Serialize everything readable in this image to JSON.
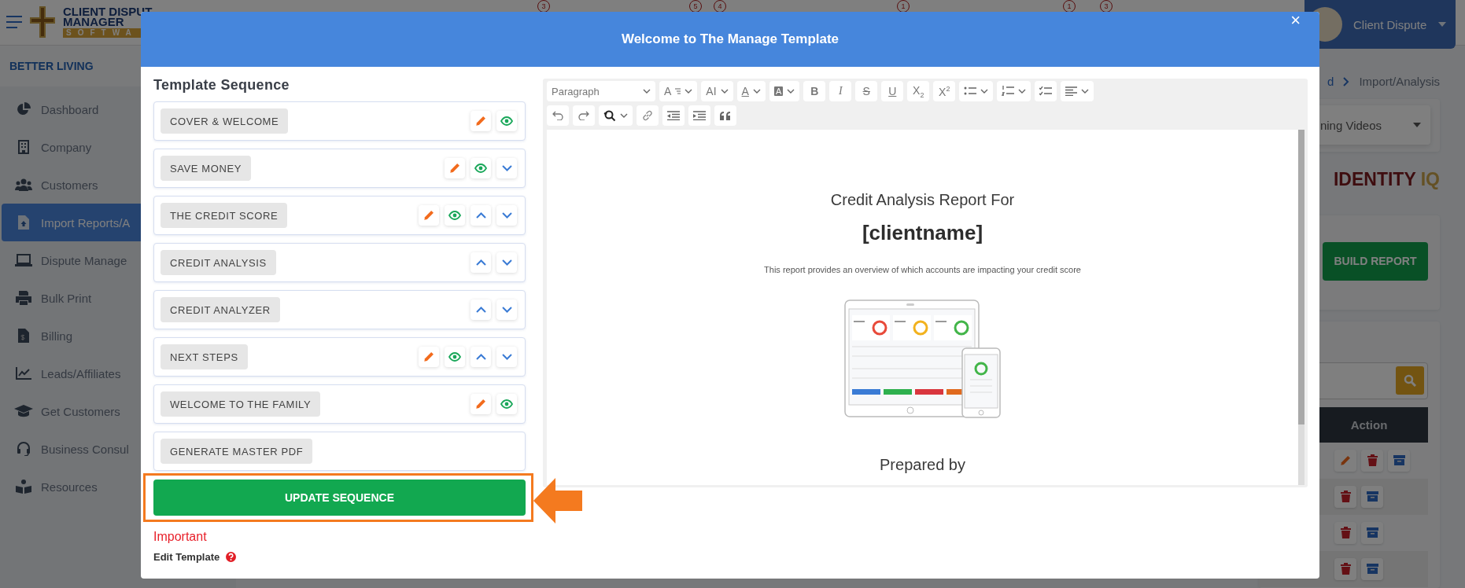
{
  "app": {
    "logo": {
      "line_1": "CLIENT DISPUT",
      "line_2": "MANAGER",
      "line_3": "SOFTWA"
    },
    "notification_badges": [
      "3",
      "5",
      "4",
      "1",
      "1",
      "3"
    ],
    "user_menu": {
      "name": "Client Dispute"
    },
    "organization": "BETTER LIVING",
    "sidebar": {
      "items": [
        {
          "label": "Dashboard",
          "selected": false
        },
        {
          "label": "Company",
          "selected": false
        },
        {
          "label": "Customers",
          "selected": false
        },
        {
          "label": "Import Reports/A",
          "selected": true
        },
        {
          "label": "Dispute Manage",
          "selected": false
        },
        {
          "label": "Bulk Print",
          "selected": false
        },
        {
          "label": "Billing",
          "selected": false
        },
        {
          "label": "Leads/Affiliates",
          "selected": false
        },
        {
          "label": "Get Customers",
          "selected": false
        },
        {
          "label": "Business Consul",
          "selected": false
        },
        {
          "label": "Resources",
          "selected": false
        }
      ]
    },
    "breadcrumb": {
      "link": "d",
      "current": "Import/Analysis"
    },
    "video_dropdown": {
      "value": "ning Videos"
    },
    "brand": {
      "name": "IDENTITY",
      "suffix": "IQ"
    },
    "build_report_button": "BUILD REPORT",
    "table": {
      "columns": [
        "Action"
      ],
      "rows": [
        {
          "actions": [
            {
              "kind": "edit"
            },
            {
              "kind": "delete"
            },
            {
              "kind": "archive"
            }
          ]
        },
        {
          "actions": [
            {
              "kind": "delete"
            },
            {
              "kind": "archive"
            }
          ]
        },
        {
          "actions": [
            {
              "kind": "delete"
            },
            {
              "kind": "archive"
            }
          ]
        },
        {
          "actions": [
            {
              "kind": "delete"
            },
            {
              "kind": "archive"
            }
          ]
        }
      ]
    }
  },
  "modal": {
    "title": "Welcome to The Manage Template",
    "close": "×",
    "sequence_title": "Template Sequence",
    "sections": [
      {
        "label": "COVER & WELCOME",
        "actions": [
          {
            "kind": "edit"
          },
          {
            "kind": "view"
          }
        ]
      },
      {
        "label": "SAVE MONEY",
        "actions": [
          {
            "kind": "edit"
          },
          {
            "kind": "view"
          },
          {
            "kind": "down"
          }
        ]
      },
      {
        "label": "THE CREDIT SCORE",
        "actions": [
          {
            "kind": "edit"
          },
          {
            "kind": "view"
          },
          {
            "kind": "up"
          },
          {
            "kind": "down"
          }
        ]
      },
      {
        "label": "CREDIT ANALYSIS",
        "actions": [
          {
            "kind": "up"
          },
          {
            "kind": "down"
          }
        ]
      },
      {
        "label": "CREDIT ANALYZER",
        "actions": [
          {
            "kind": "up"
          },
          {
            "kind": "down"
          }
        ]
      },
      {
        "label": "NEXT STEPS",
        "actions": [
          {
            "kind": "edit"
          },
          {
            "kind": "view"
          },
          {
            "kind": "up"
          },
          {
            "kind": "down"
          }
        ]
      },
      {
        "label": "WELCOME TO THE FAMILY",
        "actions": [
          {
            "kind": "edit"
          },
          {
            "kind": "view"
          }
        ]
      },
      {
        "label": "GENERATE MASTER PDF"
      }
    ],
    "update_button": "UPDATE SEQUENCE",
    "important_label": "Important",
    "edit_template_label": "Edit Template",
    "editor": {
      "toolbar": [
        [
          {
            "kind": "select",
            "label": "Paragraph",
            "dropdown": true
          },
          {
            "kind": "font-size",
            "label": "A",
            "dropdown": true
          },
          {
            "kind": "font-family",
            "label": "AI",
            "dropdown": true
          },
          {
            "kind": "font-color",
            "label": "A",
            "dropdown": true
          },
          {
            "kind": "highlight",
            "label": "A",
            "dropdown": true
          },
          {
            "kind": "bold",
            "label": "B",
            "dropdown": false
          },
          {
            "kind": "italic",
            "label": "I",
            "dropdown": false
          },
          {
            "kind": "strikethrough",
            "label": "S",
            "dropdown": false
          },
          {
            "kind": "underline",
            "label": "U",
            "dropdown": false
          },
          {
            "kind": "subscript",
            "label": "X$_{2}$",
            "dropdown": false
          },
          {
            "kind": "superscript",
            "label": "X$^{2}$",
            "dropdown": false
          },
          {
            "kind": "bulleted-list",
            "dropdown": true
          },
          {
            "kind": "numbered-list",
            "dropdown": true
          },
          {
            "kind": "todo-list",
            "dropdown": false
          },
          {
            "kind": "alignment",
            "dropdown": true
          }
        ],
        [
          {
            "kind": "undo",
            "dropdown": false
          },
          {
            "kind": "redo",
            "dropdown": false
          },
          {
            "kind": "find-replace",
            "dropdown": true
          },
          {
            "kind": "link",
            "dropdown": false
          },
          {
            "kind": "outdent",
            "dropdown": false
          },
          {
            "kind": "indent",
            "dropdown": false
          },
          {
            "kind": "blockquote",
            "dropdown": false
          }
        ]
      ],
      "content": {
        "heading": "Credit Analysis Report For",
        "client_name": "[clientname]",
        "description": "This report provides an overview of which accounts are impacting your credit score",
        "footer": "Prepared by"
      }
    }
  }
}
